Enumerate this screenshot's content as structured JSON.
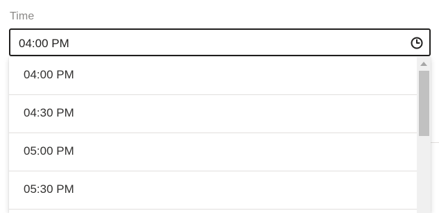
{
  "field": {
    "label": "Time",
    "value": "04:00 PM",
    "icon": "clock-icon"
  },
  "dropdown": {
    "options": [
      {
        "label": "04:00 PM"
      },
      {
        "label": "04:30 PM"
      },
      {
        "label": "05:00 PM"
      },
      {
        "label": "05:30 PM"
      }
    ],
    "scroll_position": 0
  },
  "colors": {
    "border_focus": "#201f1e",
    "label": "#8a8886",
    "divider": "#e1dfdd",
    "scroll_track": "#f0f0f0",
    "scroll_thumb": "#c1c1c1"
  }
}
